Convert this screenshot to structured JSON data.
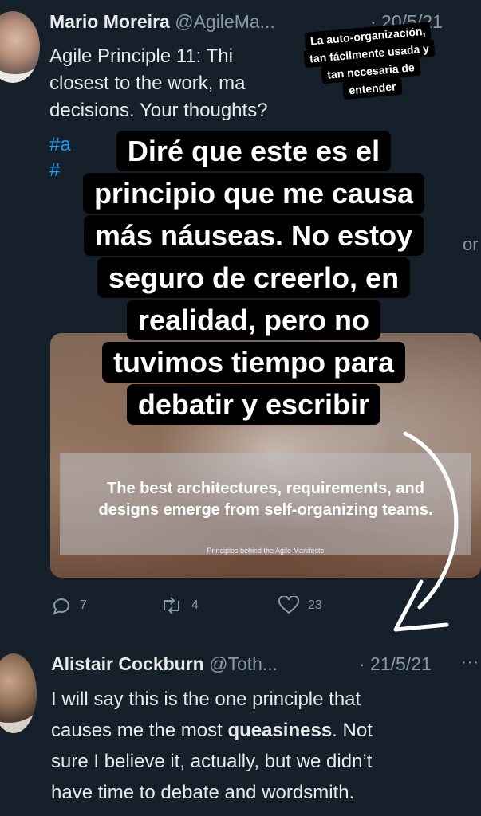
{
  "tweet1": {
    "name": "Mario Moreira",
    "handle": "@AgileMa...",
    "date": "· 20/5/21",
    "lines": [
      "Agile Principle 11: Thi",
      "closest to the work, ma",
      "decisions. Your thoughts?"
    ],
    "hashtag1": "#a",
    "hashtag2": "#",
    "faded_text": "or",
    "media": {
      "quote_line1": "The best architectures, requirements, and",
      "quote_line2": "designs emerge from self-organizing teams.",
      "credit": "Principles behind the Agile Manifesto"
    },
    "actions": {
      "reply_count": "7",
      "retweet_count": "4",
      "like_count": "23"
    }
  },
  "tweet2": {
    "name": "Alistair Cockburn",
    "handle": "@Toth...",
    "date": "· 21/5/21",
    "more": "···",
    "line1": "I will say this is the one principle that",
    "line2_pre": "causes me the most ",
    "line2_bold": "queasiness",
    "line2_post": ". Not",
    "line3": "sure I believe it, actually, but we didn’t",
    "line4": "have time to debate and wordsmith."
  },
  "overlay_small": {
    "lines": [
      "La auto-organización,",
      "tan fácilmente usada y",
      "tan necesaria de",
      "entender"
    ]
  },
  "overlay_big": {
    "lines": [
      "Diré que este es el",
      "principio que me causa",
      "más náuseas. No estoy",
      "seguro de creerlo, en",
      "realidad, pero no",
      "tuvimos tiempo para",
      "debatir y escribir"
    ]
  },
  "colors": {
    "background": "#15202b",
    "text": "#e7e9ea",
    "muted": "#8b98a5",
    "link": "#1d9bf0",
    "caption_bg": "#000000"
  }
}
